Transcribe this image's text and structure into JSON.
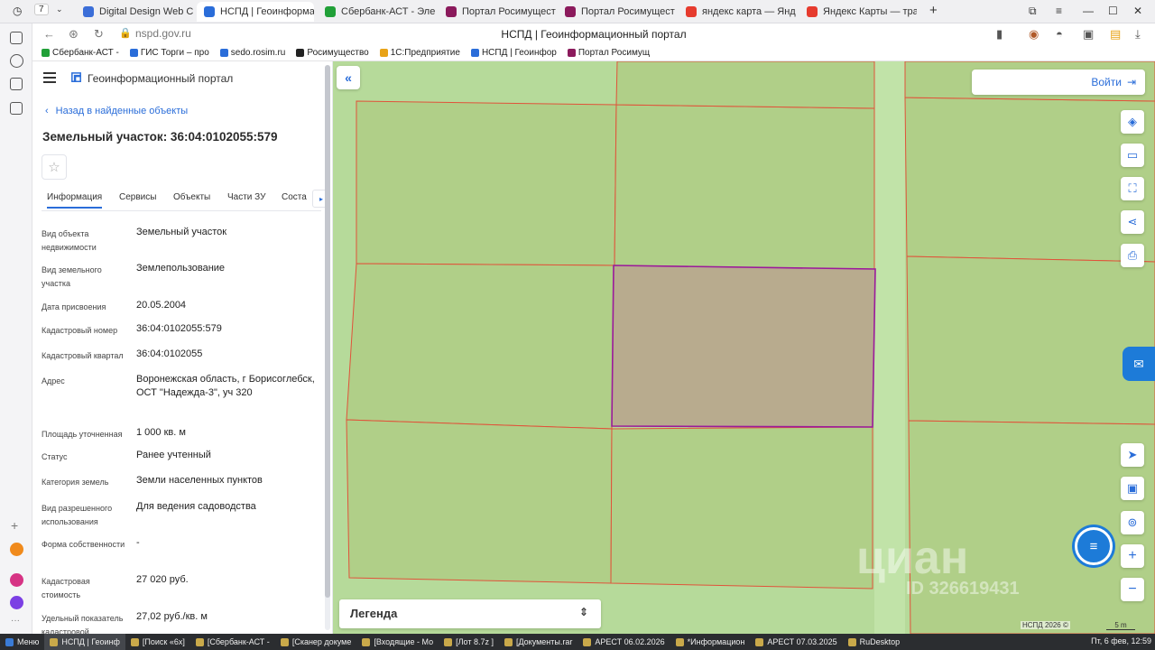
{
  "browser": {
    "tabs": [
      {
        "label": "Digital Design Web Client",
        "color": "#3b6ed8"
      },
      {
        "label": "НСПД | Геоинформаци",
        "color": "#2a6dd9",
        "active": true
      },
      {
        "label": "Сбербанк-АСТ - Электро",
        "color": "#21a038"
      },
      {
        "label": "Портал Росимущества",
        "color": "#8b1a5c"
      },
      {
        "label": "Портал Росимущества",
        "color": "#8b1a5c"
      },
      {
        "label": "яндекс карта — Яндекс",
        "color": "#e63b2e"
      },
      {
        "label": "Яндекс Карты — трансп",
        "color": "#e63b2e"
      }
    ],
    "tab_count": "7",
    "url": "nspd.gov.ru",
    "page_title": "НСПД | Геоинформационный портал",
    "bookmarks": [
      {
        "label": "Сбербанк-АСТ -",
        "color": "#21a038"
      },
      {
        "label": "ГИС Торги – про",
        "color": "#2a6dd9"
      },
      {
        "label": "sedo.rosim.ru",
        "color": "#2a6dd9"
      },
      {
        "label": "Росимущество",
        "color": "#222222"
      },
      {
        "label": "1С:Предприятие",
        "color": "#e8a317"
      },
      {
        "label": "НСПД | Геоинфор",
        "color": "#2a6dd9"
      },
      {
        "label": "Портал Росимущ",
        "color": "#8b1a5c"
      }
    ]
  },
  "panel": {
    "portal_name": "Геоинформационный портал",
    "back_label": "Назад в найденные объекты",
    "title": "Земельный участок: 36:04:0102055:579",
    "tabs": [
      "Информация",
      "Сервисы",
      "Объекты",
      "Части ЗУ",
      "Соста"
    ],
    "rows": [
      {
        "label": "Вид объекта недвижимости",
        "value": "Земельный участок"
      },
      {
        "label": "Вид земельного участка",
        "value": "Землепользование"
      },
      {
        "label": "Дата присвоения",
        "value": "20.05.2004"
      },
      {
        "label": "Кадастровый номер",
        "value": "36:04:0102055:579"
      },
      {
        "label": "Кадастровый квартал",
        "value": "36:04:0102055"
      },
      {
        "label": "Адрес",
        "value": "Воронежская область, г Борисоглебск, ОСТ \"Надежда-3\", уч 320"
      },
      {
        "label": "Площадь уточненная",
        "value": "1 000 кв. м"
      },
      {
        "label": "Статус",
        "value": "Ранее учтенный"
      },
      {
        "label": "Категория земель",
        "value": "Земли населенных пунктов"
      },
      {
        "label": "Вид разрешенного использования",
        "value": "Для ведения садоводства"
      },
      {
        "label": "Форма собственности",
        "value": "-"
      },
      {
        "label": "Кадастровая стоимость",
        "value": "27 020 руб."
      },
      {
        "label": "Удельный показатель кадастровой",
        "value": "27,02 руб./кв. м"
      }
    ]
  },
  "map": {
    "login_label": "Войти",
    "legend_label": "Легенда",
    "watermark": "циан",
    "watermark_id": "ID 326619431",
    "copyright": "НСПД 2026 ©",
    "scale_label": "5 m",
    "land_color": "#b6da9a",
    "selected_fill": "#b8ab8e",
    "selected_stroke": "#9b1a9b",
    "parcel_line": "#e0533a"
  },
  "taskbar": {
    "menu": "Меню",
    "items": [
      {
        "label": "НСПД | Геоинф",
        "active": true
      },
      {
        "label": "[Поиск «6x]"
      },
      {
        "label": "[Сбербанк-АСТ -"
      },
      {
        "label": "[Сканер докуме"
      },
      {
        "label": "[Входящие - Мо"
      },
      {
        "label": "[Лот 8.7z ]"
      },
      {
        "label": "[Документы.rar"
      },
      {
        "label": "АРЕСТ 06.02.2026"
      },
      {
        "label": "*Информацион"
      },
      {
        "label": "АРЕСТ 07.03.2025"
      },
      {
        "label": "RuDesktop"
      }
    ],
    "clock": "Пт, 6 фев, 12:59"
  }
}
